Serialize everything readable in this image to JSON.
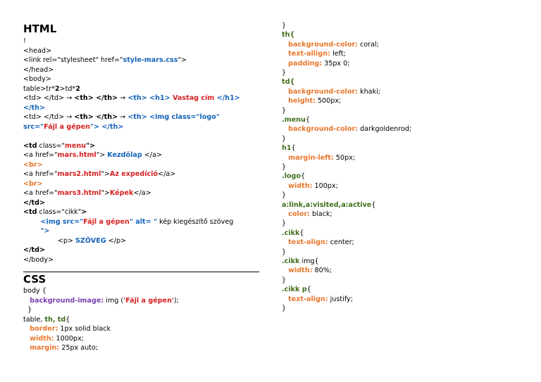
{
  "colors": {
    "blue": "#1463b8",
    "red": "#d61f1f",
    "orange": "#e8772e",
    "purple": "#7a3db0",
    "green": "#3f6e1a"
  },
  "html_section": {
    "title": "HTML",
    "lines": [
      [
        {
          "t": "!"
        }
      ],
      [
        {
          "t": "<head>"
        }
      ],
      [
        {
          "t": "<link rel=\""
        },
        {
          "t": "stylesheet"
        },
        {
          "t": "\" href=\""
        },
        {
          "t": "style-mars.css",
          "c": "blue",
          "b": 1
        },
        {
          "t": "\">"
        }
      ],
      [
        {
          "t": "</head>"
        }
      ],
      [
        {
          "t": "<body>"
        }
      ],
      [
        {
          "t": "table>tr*"
        },
        {
          "t": "2",
          "b": 1
        },
        {
          "t": ">td*"
        },
        {
          "t": "2",
          "b": 1
        }
      ],
      [
        {
          "t": "<td> </td> → "
        },
        {
          "t": "<th> </th>",
          "b": 1
        },
        {
          "t": " → "
        },
        {
          "t": "<th> <h1> ",
          "c": "blue",
          "b": 1
        },
        {
          "t": "Vastag cím",
          "c": "red",
          "b": 1
        },
        {
          "t": " </h1>",
          "c": "blue",
          "b": 1
        }
      ],
      [
        {
          "t": "</th>",
          "c": "blue",
          "b": 1
        }
      ],
      [
        {
          "t": "<td> </td> → "
        },
        {
          "t": "<th> </th>",
          "b": 1
        },
        {
          "t": " → "
        },
        {
          "t": "<th> <img class=\"logo\"",
          "c": "blue",
          "b": 1
        }
      ],
      [
        {
          "t": "src=\"",
          "c": "blue",
          "b": 1
        },
        {
          "t": "Fájl a gépen",
          "c": "red",
          "b": 1
        },
        {
          "t": "\"> </th>",
          "c": "blue",
          "b": 1
        }
      ],
      [
        {
          "t": ""
        }
      ],
      [
        {
          "t": "<td",
          "b": 1
        },
        {
          "t": " class=\""
        },
        {
          "t": "menu",
          "c": "red",
          "b": 1
        },
        {
          "t": "\">",
          "b": 1
        }
      ],
      [
        {
          "t": "<a href=\""
        },
        {
          "t": "mars.html",
          "c": "red",
          "b": 1
        },
        {
          "t": "\"> "
        },
        {
          "t": "Kezdőlap",
          "c": "blue",
          "b": 1
        },
        {
          "t": " </a>"
        }
      ],
      [
        {
          "t": "<br>",
          "c": "orange",
          "b": 1
        }
      ],
      [
        {
          "t": "<a href=\""
        },
        {
          "t": "mars2.html",
          "c": "red",
          "b": 1
        },
        {
          "t": "\">"
        },
        {
          "t": "Az expedíció",
          "c": "red",
          "b": 1
        },
        {
          "t": "</a>"
        }
      ],
      [
        {
          "t": "<br>",
          "c": "orange",
          "b": 1
        }
      ],
      [
        {
          "t": "<a href=\""
        },
        {
          "t": "mars3.html",
          "c": "red",
          "b": 1
        },
        {
          "t": "\">"
        },
        {
          "t": "Képek",
          "c": "red",
          "b": 1
        },
        {
          "t": "</a>"
        }
      ],
      [
        {
          "t": "</td>",
          "b": 1
        }
      ],
      [
        {
          "t": "<td",
          "b": 1
        },
        {
          "t": " class=\"cikk\""
        },
        {
          "t": ">",
          "b": 1
        }
      ],
      [
        {
          "t": "        "
        },
        {
          "t": "<img src=\"",
          "c": "blue",
          "b": 1
        },
        {
          "t": "Fájl a gépen",
          "c": "red",
          "b": 1
        },
        {
          "t": "\" alt= \"",
          "c": "blue",
          "b": 1
        },
        {
          "t": " kép kiegészítő szöveg"
        }
      ],
      [
        {
          "t": "        "
        },
        {
          "t": "\">",
          "c": "blue",
          "b": 1
        }
      ],
      [
        {
          "t": "                <p> "
        },
        {
          "t": "SZÖVEG",
          "c": "blue",
          "b": 1
        },
        {
          "t": " </p>"
        }
      ],
      [
        {
          "t": "</td>",
          "b": 1
        }
      ],
      [
        {
          "t": "</body>"
        }
      ]
    ]
  },
  "css_section": {
    "title": "CSS",
    "lines": [
      [
        {
          "t": "body {"
        }
      ],
      [
        {
          "t": "   "
        },
        {
          "t": "background-image:",
          "c": "purple",
          "b": 1
        },
        {
          "t": " img ("
        },
        {
          "t": "'Fájl a gépen'",
          "c": "red",
          "b": 1
        },
        {
          "t": ");"
        }
      ],
      [
        {
          "t": "  }"
        }
      ],
      [
        {
          "t": "table, "
        },
        {
          "t": "th, td",
          "c": "green",
          "b": 1
        },
        {
          "t": "{"
        }
      ],
      [
        {
          "t": "   "
        },
        {
          "t": "border:",
          "c": "orange",
          "b": 1
        },
        {
          "t": " 1px solid black"
        }
      ],
      [
        {
          "t": "   "
        },
        {
          "t": "width:",
          "c": "orange",
          "b": 1
        },
        {
          "t": " 1000px;"
        }
      ],
      [
        {
          "t": "   "
        },
        {
          "t": "margin:",
          "c": "orange",
          "b": 1
        },
        {
          "t": " 25px auto;"
        }
      ]
    ]
  },
  "right_column": {
    "lines": [
      [
        {
          "t": "}"
        }
      ],
      [
        {
          "t": "th{",
          "c": "green",
          "b": 1
        }
      ],
      [
        {
          "t": "   "
        },
        {
          "t": "background-color:",
          "c": "orange",
          "b": 1
        },
        {
          "t": " coral;"
        }
      ],
      [
        {
          "t": "   "
        },
        {
          "t": "text-allign:",
          "c": "orange",
          "b": 1
        },
        {
          "t": " left;"
        }
      ],
      [
        {
          "t": "   "
        },
        {
          "t": "padding:",
          "c": "orange",
          "b": 1
        },
        {
          "t": " 35px 0;"
        }
      ],
      [
        {
          "t": "}"
        }
      ],
      [
        {
          "t": "td{",
          "c": "green",
          "b": 1
        }
      ],
      [
        {
          "t": "   "
        },
        {
          "t": "background-color:",
          "c": "orange",
          "b": 1
        },
        {
          "t": " khaki;"
        }
      ],
      [
        {
          "t": "   "
        },
        {
          "t": "height:",
          "c": "orange",
          "b": 1
        },
        {
          "t": " 500px;"
        }
      ],
      [
        {
          "t": "}"
        }
      ],
      [
        {
          "t": ".menu",
          "c": "green",
          "b": 1
        },
        {
          "t": "{"
        }
      ],
      [
        {
          "t": "   "
        },
        {
          "t": "background-color:",
          "c": "orange",
          "b": 1
        },
        {
          "t": " darkgoldenrod;"
        }
      ],
      [
        {
          "t": "}"
        }
      ],
      [
        {
          "t": "h1",
          "c": "green",
          "b": 1
        },
        {
          "t": "{"
        }
      ],
      [
        {
          "t": "   "
        },
        {
          "t": "margin-left:",
          "c": "orange",
          "b": 1
        },
        {
          "t": " 50px;"
        }
      ],
      [
        {
          "t": "}"
        }
      ],
      [
        {
          "t": ".logo",
          "c": "green",
          "b": 1
        },
        {
          "t": "{"
        }
      ],
      [
        {
          "t": "   "
        },
        {
          "t": "width:",
          "c": "orange",
          "b": 1
        },
        {
          "t": " 100px;"
        }
      ],
      [
        {
          "t": "}"
        }
      ],
      [
        {
          "t": "a:link,a:visited,a:active",
          "c": "green",
          "b": 1
        },
        {
          "t": "{"
        }
      ],
      [
        {
          "t": "   "
        },
        {
          "t": "color:",
          "c": "orange",
          "b": 1
        },
        {
          "t": " black;"
        }
      ],
      [
        {
          "t": "}"
        }
      ],
      [
        {
          "t": ".cikk",
          "c": "green",
          "b": 1
        },
        {
          "t": "{"
        }
      ],
      [
        {
          "t": "   "
        },
        {
          "t": "text-align:",
          "c": "orange",
          "b": 1
        },
        {
          "t": " center;"
        }
      ],
      [
        {
          "t": "}"
        }
      ],
      [
        {
          "t": ".cikk",
          "c": "green",
          "b": 1
        },
        {
          "t": " img{"
        }
      ],
      [
        {
          "t": "   "
        },
        {
          "t": "width:",
          "c": "orange",
          "b": 1
        },
        {
          "t": " 80%;"
        }
      ],
      [
        {
          "t": "}"
        }
      ],
      [
        {
          "t": ".cikk p",
          "c": "green",
          "b": 1
        },
        {
          "t": "{"
        }
      ],
      [
        {
          "t": "   "
        },
        {
          "t": "text-align:",
          "c": "orange",
          "b": 1
        },
        {
          "t": " justify;"
        }
      ],
      [
        {
          "t": "}"
        }
      ]
    ]
  }
}
